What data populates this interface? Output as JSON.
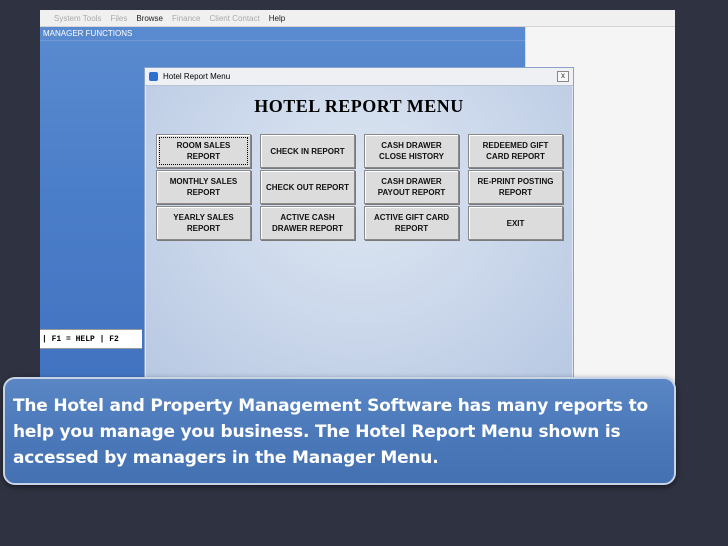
{
  "menubar": {
    "items": [
      "System Tools",
      "Files",
      "Browse",
      "Finance",
      "Client Contact",
      "Help"
    ],
    "active": [
      false,
      false,
      true,
      false,
      false,
      true
    ]
  },
  "manager_title": "MANAGER FUNCTIONS",
  "function_keys": "| F1 = HELP | F2",
  "dialog": {
    "title": "Hotel Report Menu",
    "close_label": "x",
    "heading": "HOTEL REPORT MENU",
    "buttons": [
      "ROOM SALES\nREPORT",
      "CHECK IN REPORT",
      "CASH DRAWER\nCLOSE HISTORY",
      "REDEEMED GIFT\nCARD REPORT",
      "MONTHLY SALES\nREPORT",
      "CHECK OUT REPORT",
      "CASH DRAWER\nPAYOUT REPORT",
      "RE-PRINT POSTING\nREPORT",
      "YEARLY SALES\nREPORT",
      "ACTIVE CASH\nDRAWER REPORT",
      "ACTIVE GIFT CARD\nREPORT",
      "EXIT"
    ]
  },
  "callout": {
    "text": "The Hotel and Property Management Software has many reports to help you manage you business.  The Hotel Report Menu shown is accessed  by managers in the Manager Menu."
  },
  "colors": {
    "slide_background": "#2f3240",
    "callout_blue": "#4a78b9",
    "manager_pane_blue": "#4b7ec9"
  }
}
